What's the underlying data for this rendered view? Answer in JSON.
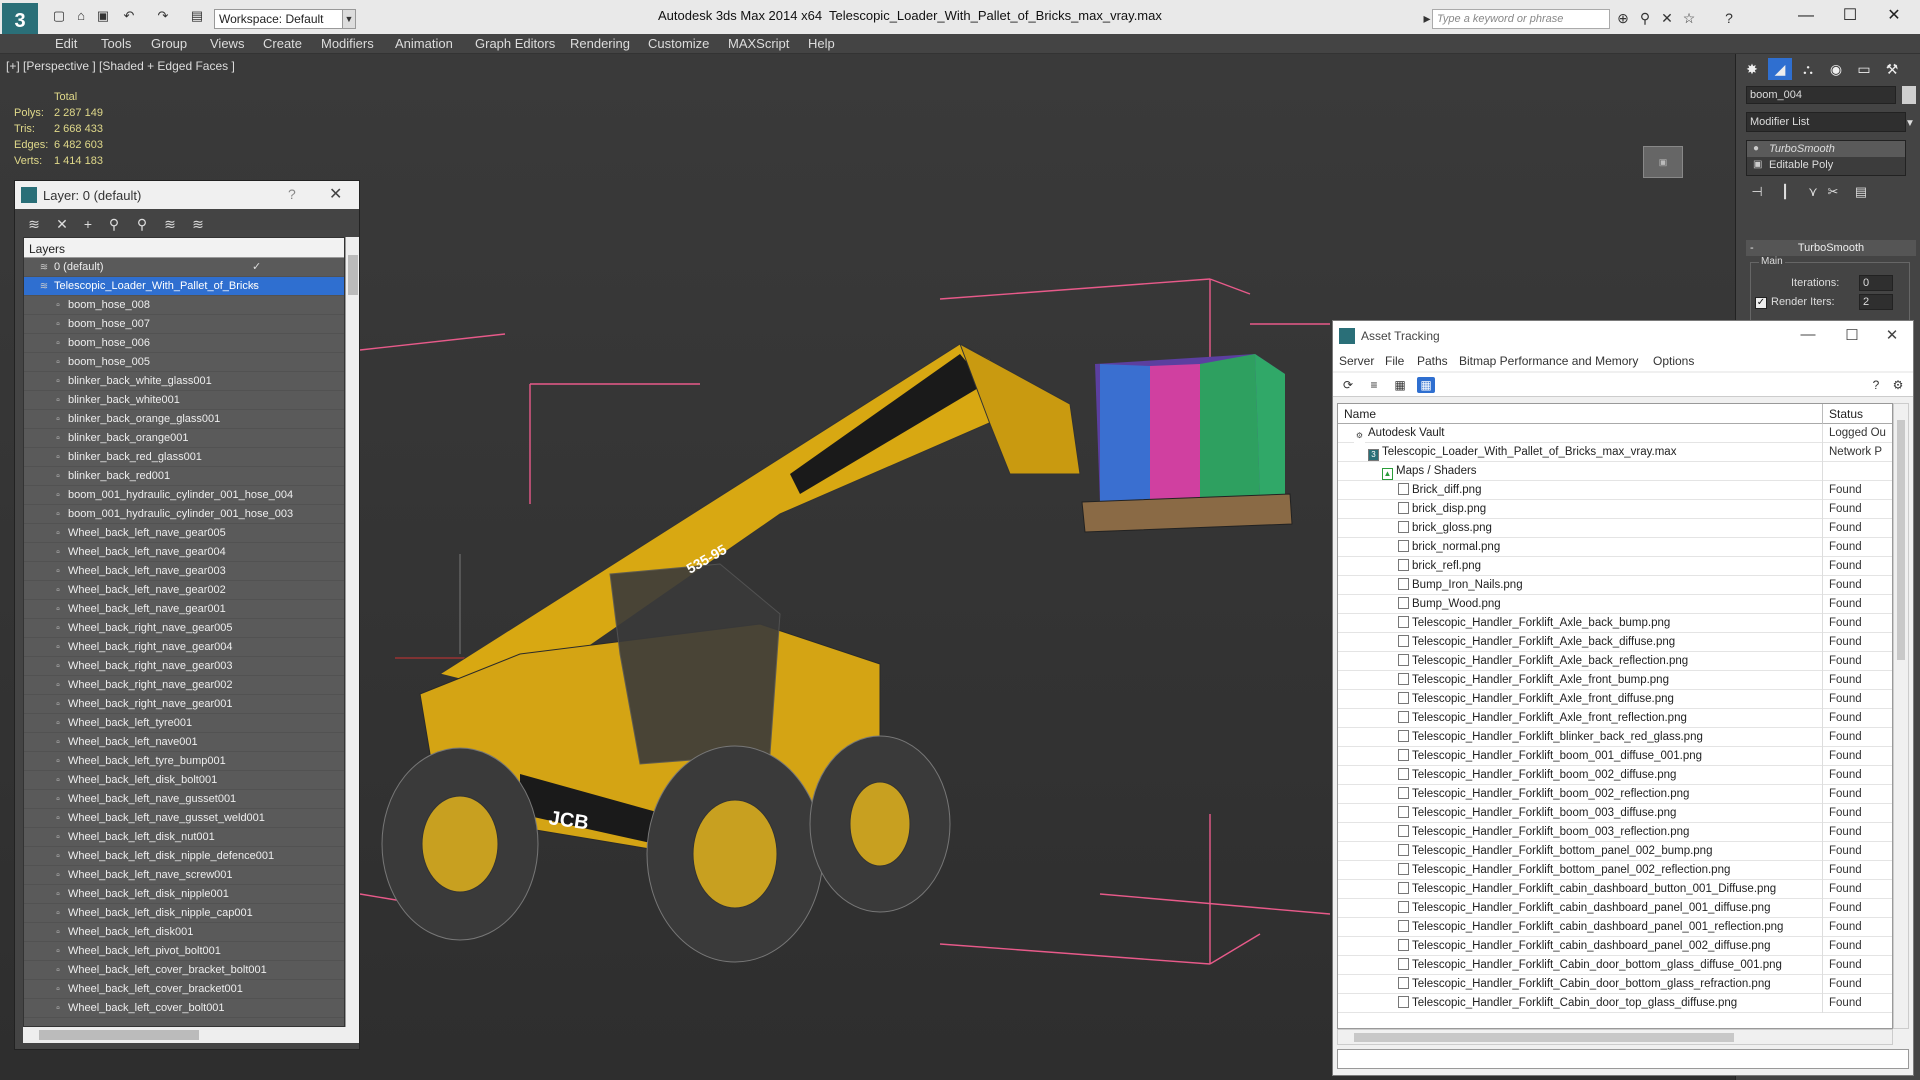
{
  "titlebar": {
    "workspace": "Workspace: Default",
    "app_title": "Autodesk 3ds Max  2014 x64",
    "file_title": "Telescopic_Loader_With_Pallet_of_Bricks_max_vray.max",
    "search_placeholder": "Type a keyword or phrase"
  },
  "menubar": [
    "Edit",
    "Tools",
    "Group",
    "Views",
    "Create",
    "Modifiers",
    "Animation",
    "Graph Editors",
    "Rendering",
    "Customize",
    "MAXScript",
    "Help"
  ],
  "viewport": {
    "label": "[+] [Perspective ] [Shaded + Edged Faces ]",
    "stats": {
      "header": "Total",
      "rows": [
        {
          "label": "Polys:",
          "value": "2 287 149"
        },
        {
          "label": "Tris:",
          "value": "2 668 433"
        },
        {
          "label": "Edges:",
          "value": "6 482 603"
        },
        {
          "label": "Verts:",
          "value": "1 414 183"
        }
      ]
    },
    "scene_text": {
      "brand": "JCB",
      "model": "535-95"
    }
  },
  "layer_dialog": {
    "title": "Layer: 0 (default)",
    "list_header": "Layers",
    "items": [
      {
        "label": "0 (default)",
        "level": 0,
        "type": "layer"
      },
      {
        "label": "Telescopic_Loader_With_Pallet_of_Bricks",
        "level": 0,
        "type": "layer",
        "selected": true
      },
      {
        "label": "boom_hose_008",
        "level": 1
      },
      {
        "label": "boom_hose_007",
        "level": 1
      },
      {
        "label": "boom_hose_006",
        "level": 1
      },
      {
        "label": "boom_hose_005",
        "level": 1
      },
      {
        "label": "blinker_back_white_glass001",
        "level": 1
      },
      {
        "label": "blinker_back_white001",
        "level": 1
      },
      {
        "label": "blinker_back_orange_glass001",
        "level": 1
      },
      {
        "label": "blinker_back_orange001",
        "level": 1
      },
      {
        "label": "blinker_back_red_glass001",
        "level": 1
      },
      {
        "label": "blinker_back_red001",
        "level": 1
      },
      {
        "label": "boom_001_hydraulic_cylinder_001_hose_004",
        "level": 1
      },
      {
        "label": "boom_001_hydraulic_cylinder_001_hose_003",
        "level": 1
      },
      {
        "label": "Wheel_back_left_nave_gear005",
        "level": 1
      },
      {
        "label": "Wheel_back_left_nave_gear004",
        "level": 1
      },
      {
        "label": "Wheel_back_left_nave_gear003",
        "level": 1
      },
      {
        "label": "Wheel_back_left_nave_gear002",
        "level": 1
      },
      {
        "label": "Wheel_back_left_nave_gear001",
        "level": 1
      },
      {
        "label": "Wheel_back_right_nave_gear005",
        "level": 1
      },
      {
        "label": "Wheel_back_right_nave_gear004",
        "level": 1
      },
      {
        "label": "Wheel_back_right_nave_gear003",
        "level": 1
      },
      {
        "label": "Wheel_back_right_nave_gear002",
        "level": 1
      },
      {
        "label": "Wheel_back_right_nave_gear001",
        "level": 1
      },
      {
        "label": "Wheel_back_left_tyre001",
        "level": 1
      },
      {
        "label": "Wheel_back_left_nave001",
        "level": 1
      },
      {
        "label": "Wheel_back_left_tyre_bump001",
        "level": 1
      },
      {
        "label": "Wheel_back_left_disk_bolt001",
        "level": 1
      },
      {
        "label": "Wheel_back_left_nave_gusset001",
        "level": 1
      },
      {
        "label": "Wheel_back_left_nave_gusset_weld001",
        "level": 1
      },
      {
        "label": "Wheel_back_left_disk_nut001",
        "level": 1
      },
      {
        "label": "Wheel_back_left_disk_nipple_defence001",
        "level": 1
      },
      {
        "label": "Wheel_back_left_nave_screw001",
        "level": 1
      },
      {
        "label": "Wheel_back_left_disk_nipple001",
        "level": 1
      },
      {
        "label": "Wheel_back_left_disk_nipple_cap001",
        "level": 1
      },
      {
        "label": "Wheel_back_left_disk001",
        "level": 1
      },
      {
        "label": "Wheel_back_left_pivot_bolt001",
        "level": 1
      },
      {
        "label": "Wheel_back_left_cover_bracket_bolt001",
        "level": 1
      },
      {
        "label": "Wheel_back_left_cover_bracket001",
        "level": 1
      },
      {
        "label": "Wheel_back_left_cover_bolt001",
        "level": 1
      }
    ]
  },
  "command_panel": {
    "object_name": "boom_004",
    "modifier_list": "Modifier List",
    "stack": [
      "TurboSmooth",
      "Editable Poly"
    ],
    "rollout_title": "TurboSmooth",
    "group_main": "Main",
    "iterations_label": "Iterations:",
    "iterations_value": "0",
    "render_iters_label": "Render Iters:",
    "render_iters_value": "2"
  },
  "asset_tracking": {
    "title": "Asset Tracking",
    "menu": [
      "Server",
      "File",
      "Paths",
      "Bitmap Performance and Memory",
      "Options"
    ],
    "columns": {
      "name": "Name",
      "status": "Status"
    },
    "rows": [
      {
        "name": "Autodesk Vault",
        "status": "Logged Ou",
        "level": 0,
        "icon": "vault"
      },
      {
        "name": "Telescopic_Loader_With_Pallet_of_Bricks_max_vray.max",
        "status": "Network P",
        "level": 1,
        "icon": "max"
      },
      {
        "name": "Maps / Shaders",
        "status": "",
        "level": 2,
        "icon": "maps"
      },
      {
        "name": "Brick_diff.png",
        "status": "Found",
        "level": 3
      },
      {
        "name": "brick_disp.png",
        "status": "Found",
        "level": 3
      },
      {
        "name": "brick_gloss.png",
        "status": "Found",
        "level": 3
      },
      {
        "name": "brick_normal.png",
        "status": "Found",
        "level": 3
      },
      {
        "name": "brick_refl.png",
        "status": "Found",
        "level": 3
      },
      {
        "name": "Bump_Iron_Nails.png",
        "status": "Found",
        "level": 3
      },
      {
        "name": "Bump_Wood.png",
        "status": "Found",
        "level": 3
      },
      {
        "name": "Telescopic_Handler_Forklift_Axle_back_bump.png",
        "status": "Found",
        "level": 3
      },
      {
        "name": "Telescopic_Handler_Forklift_Axle_back_diffuse.png",
        "status": "Found",
        "level": 3
      },
      {
        "name": "Telescopic_Handler_Forklift_Axle_back_reflection.png",
        "status": "Found",
        "level": 3
      },
      {
        "name": "Telescopic_Handler_Forklift_Axle_front_bump.png",
        "status": "Found",
        "level": 3
      },
      {
        "name": "Telescopic_Handler_Forklift_Axle_front_diffuse.png",
        "status": "Found",
        "level": 3
      },
      {
        "name": "Telescopic_Handler_Forklift_Axle_front_reflection.png",
        "status": "Found",
        "level": 3
      },
      {
        "name": "Telescopic_Handler_Forklift_blinker_back_red_glass.png",
        "status": "Found",
        "level": 3
      },
      {
        "name": "Telescopic_Handler_Forklift_boom_001_diffuse_001.png",
        "status": "Found",
        "level": 3
      },
      {
        "name": "Telescopic_Handler_Forklift_boom_002_diffuse.png",
        "status": "Found",
        "level": 3
      },
      {
        "name": "Telescopic_Handler_Forklift_boom_002_reflection.png",
        "status": "Found",
        "level": 3
      },
      {
        "name": "Telescopic_Handler_Forklift_boom_003_diffuse.png",
        "status": "Found",
        "level": 3
      },
      {
        "name": "Telescopic_Handler_Forklift_boom_003_reflection.png",
        "status": "Found",
        "level": 3
      },
      {
        "name": "Telescopic_Handler_Forklift_bottom_panel_002_bump.png",
        "status": "Found",
        "level": 3
      },
      {
        "name": "Telescopic_Handler_Forklift_bottom_panel_002_reflection.png",
        "status": "Found",
        "level": 3
      },
      {
        "name": "Telescopic_Handler_Forklift_cabin_dashboard_button_001_Diffuse.png",
        "status": "Found",
        "level": 3
      },
      {
        "name": "Telescopic_Handler_Forklift_cabin_dashboard_panel_001_diffuse.png",
        "status": "Found",
        "level": 3
      },
      {
        "name": "Telescopic_Handler_Forklift_cabin_dashboard_panel_001_reflection.png",
        "status": "Found",
        "level": 3
      },
      {
        "name": "Telescopic_Handler_Forklift_cabin_dashboard_panel_002_diffuse.png",
        "status": "Found",
        "level": 3
      },
      {
        "name": "Telescopic_Handler_Forklift_Cabin_door_bottom_glass_diffuse_001.png",
        "status": "Found",
        "level": 3
      },
      {
        "name": "Telescopic_Handler_Forklift_Cabin_door_bottom_glass_refraction.png",
        "status": "Found",
        "level": 3
      },
      {
        "name": "Telescopic_Handler_Forklift_Cabin_door_top_glass_diffuse.png",
        "status": "Found",
        "level": 3
      }
    ]
  }
}
